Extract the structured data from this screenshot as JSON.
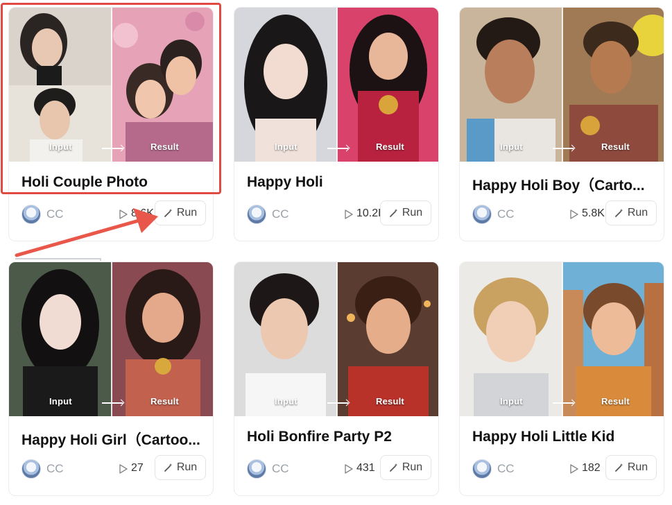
{
  "labels": {
    "input": "Input",
    "result": "Result"
  },
  "cards": [
    {
      "title": "Holi Couple Photo",
      "author": "CC",
      "views": "8.6K",
      "run": "Run"
    },
    {
      "title": "Happy Holi",
      "author": "CC",
      "views": "10.2K",
      "run": "Run"
    },
    {
      "title": "Happy Holi Boy（Carto...",
      "author": "CC",
      "views": "5.8K",
      "run": "Run"
    },
    {
      "title": "Happy Holi Girl（Cartoo...",
      "author": "CC",
      "views": "27",
      "run": "Run"
    },
    {
      "title": "Holi Bonfire Party P2",
      "author": "CC",
      "views": "431",
      "run": "Run"
    },
    {
      "title": "Happy Holi Little Kid",
      "author": "CC",
      "views": "182",
      "run": "Run"
    }
  ],
  "icons": {
    "play": "play-icon",
    "wand": "magic-wand-icon",
    "arrow": "annotation-arrow"
  },
  "colors": {
    "highlight": "#e04a43",
    "border": "#ececef",
    "author": "#9aa0a8"
  }
}
